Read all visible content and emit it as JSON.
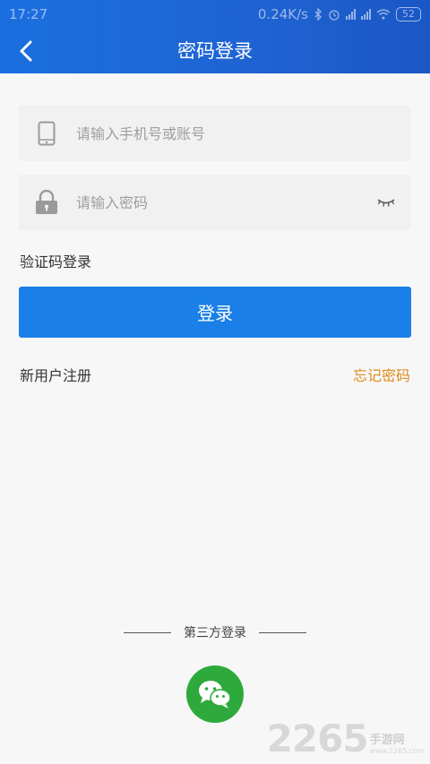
{
  "status_bar": {
    "time": "17:27",
    "network_speed": "0.24K/s",
    "battery": "52",
    "icons": [
      "bluetooth-icon",
      "alarm-icon",
      "signal-icon",
      "signal-icon",
      "wifi-icon",
      "battery-icon"
    ]
  },
  "header": {
    "title": "密码登录",
    "back_icon": "chevron-left-icon",
    "background": "#1f63d2"
  },
  "form": {
    "account_placeholder": "请输入手机号或账号",
    "account_icon": "phone-icon",
    "password_placeholder": "请输入密码",
    "password_icon": "lock-icon",
    "toggle_icon": "eye-closed-icon"
  },
  "links": {
    "sms_login": "验证码登录",
    "register": "新用户注册",
    "forgot": "忘记密码"
  },
  "login_button": {
    "label": "登录",
    "color": "#1a7fe8"
  },
  "third_party": {
    "label": "第三方登录",
    "wechat_icon": "wechat-icon",
    "wechat_color": "#2eaa3c"
  },
  "watermark": {
    "number": "2265",
    "name": "手游网",
    "url": "www.2265.com"
  },
  "colors": {
    "accent": "#1a7fe8",
    "forgot": "#e08a1c",
    "background": "#f7f7f7"
  }
}
